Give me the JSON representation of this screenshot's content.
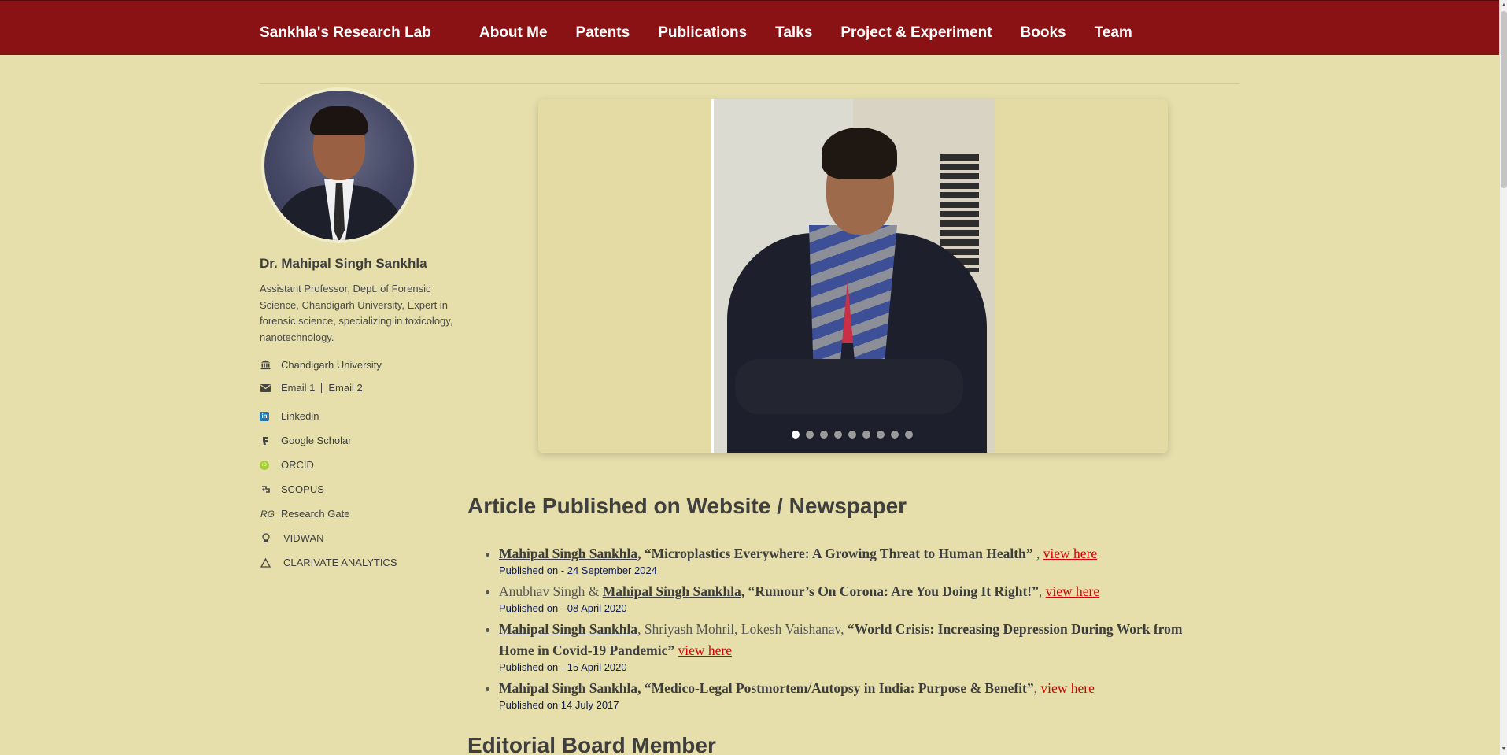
{
  "nav": {
    "brand": "Sankhla's Research Lab",
    "links": [
      "About Me",
      "Patents",
      "Publications",
      "Talks",
      "Project & Experiment",
      "Books",
      "Team"
    ]
  },
  "profile": {
    "name": "Dr. Mahipal Singh Sankhla",
    "description": "Assistant Professor, Dept. of Forensic Science, Chandigarh University, Expert in forensic science, specializing in toxicology, nanotechnology.",
    "affiliation": "Chandigarh University",
    "email1": "Email 1",
    "email2": "Email 2",
    "links": {
      "linkedin": "Linkedin",
      "scholar": "Google Scholar",
      "orcid": "ORCID",
      "scopus": "SCOPUS",
      "rg_icon": "RG",
      "researchgate": "Research Gate",
      "vidwan": "VIDWAN",
      "clarivate": "CLARIVATE ANALYTICS"
    },
    "icons": {
      "affiliation": "bank-icon",
      "email": "envelope-icon",
      "linkedin": "linkedin-icon",
      "scholar": "google-scholar-icon",
      "orcid": "orcid-icon",
      "scopus": "scopus-icon",
      "researchgate": "researchgate-icon",
      "vidwan": "lightbulb-icon",
      "clarivate": "triangle-icon"
    }
  },
  "carousel": {
    "slide_count": 9,
    "active_index": 0
  },
  "articles": {
    "heading": "Article Published on Website / Newspaper",
    "items": [
      {
        "pre": "",
        "author": "Mahipal Singh Sankhla",
        "others": "",
        "title": ", “Microplastics Everywhere: A Growing Threat to Human Health”",
        "sep": " , ",
        "link": "view here",
        "date": "Published on - 24 September 2024"
      },
      {
        "pre": "Anubhav Singh & ",
        "author": "Mahipal Singh Sankhla",
        "others": "",
        "title": ", “Rumour’s On Corona: Are You Doing It Right!”",
        "sep": ", ",
        "link": "view here",
        "date": "Published on - 08 April 2020"
      },
      {
        "pre": "",
        "author": "Mahipal Singh Sankhla",
        "others": ", Shriyash Mohril, Lokesh Vaishanav, ",
        "title": "“World Crisis: Increasing Depression During Work from Home in Covid-19 Pandemic”",
        "sep": " ",
        "link": "view here",
        "date": "Published on - 15 April 2020"
      },
      {
        "pre": "",
        "author": "Mahipal Singh Sankhla",
        "others": "",
        "title": ", “Medico-Legal Postmortem/Autopsy in India: Purpose & Benefit”",
        "sep": ", ",
        "link": "view here",
        "date": "Published on 14 July 2017"
      }
    ]
  },
  "editorial": {
    "heading": "Editorial Board Member"
  },
  "colors": {
    "nav_bg": "#8b1214",
    "page_bg": "#e6dfab",
    "link_red": "#d40000",
    "date_navy": "#0d1a52"
  }
}
